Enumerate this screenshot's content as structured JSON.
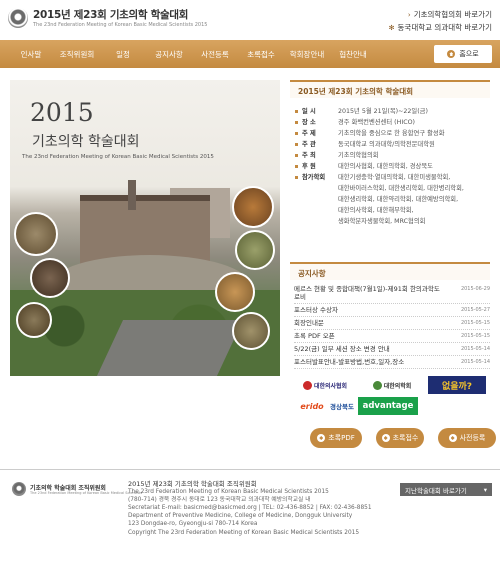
{
  "header": {
    "title": "2015년 제23회 기초의학 학술대회",
    "subtitle": "The 23nd Federation Meeting of Korean Basic Medical Scientists 2015",
    "quick_links": [
      {
        "label": "기초의학협의회 바로가기"
      },
      {
        "label": "동국대학교 의과대학 바로가기"
      }
    ]
  },
  "nav": {
    "items": [
      "인사말",
      "조직위원회",
      "일정",
      "공지사항",
      "사전등록",
      "초록접수",
      "학회장안내",
      "협찬안내"
    ],
    "home_label": "홈으로"
  },
  "hero": {
    "year": "2015",
    "title": "기초의학 학술대회",
    "subtitle_en": "The 23nd Federation Meeting of Korean Basic Medical Scientists 2015"
  },
  "info": {
    "heading": "2015년 제23회 기초의학 학술대회",
    "rows": [
      {
        "label": "일 시",
        "value": "2015년 5월 21일(목)~22일(금)"
      },
      {
        "label": "장 소",
        "value": "경주 화백컨벤션센터 (HICO)"
      },
      {
        "label": "주 제",
        "value": "기초의학을 중심으로 한 융합연구 활성화"
      },
      {
        "label": "주 관",
        "value": "동국대학교 의과대학/의학전문대학원"
      },
      {
        "label": "주 최",
        "value": "기초의학협의회"
      },
      {
        "label": "후 원",
        "value": "대한의사협회, 대한의학회, 경상북도"
      },
      {
        "label": "참가학회",
        "value": "대한기생충학·열대의학회, 대한미생물학회,"
      }
    ],
    "continuation": [
      "대한바이러스학회, 대한생리학회, 대한병리학회,",
      "대한생리학회, 대한약리학회, 대한예방의학회,",
      "대한의사학회, 대한해부학회,",
      "생화학분자생물학회, MRC협의회"
    ]
  },
  "notices": {
    "heading": "공지사항",
    "items": [
      {
        "title": "메르스 현황 및 종합대책(7월1일)-제91회 한의과학도 로비",
        "date": "2015-06-29"
      },
      {
        "title": "포스터상 수상자",
        "date": "2015-05-27"
      },
      {
        "title": "회장인내문",
        "date": "2015-05-15"
      },
      {
        "title": "초록 PDF 오픈",
        "date": "2015-05-15"
      },
      {
        "title": "5/22(금) 일부 세션 장소 변경 안내",
        "date": "2015-05-14"
      },
      {
        "title": "포스터발표안내-발표방법,번호,일자,장소",
        "date": "2015-05-14"
      }
    ]
  },
  "sponsors": {
    "s1": "대한의사협회",
    "s2": "대한의학회",
    "s3": "없을까?",
    "s4": "erido",
    "s5": "경상북도",
    "s6": "advantage"
  },
  "actions": {
    "abstract_pdf": "초록PDF",
    "abstract_submit": "초록접수",
    "pre_register": "사전등록"
  },
  "footer": {
    "org_name": "기초의학 학술대회 조직위원회",
    "org_sub": "The 23nd Federation Meeting of Korean Basic Medical Scientists",
    "lines": [
      "2015년 제23회 기초의학 학술대회 조직위원회",
      "The 23rd Federation Meeting of Korean Basic Medical Scientists 2015",
      "(780-714) 경북 경주시 동대로 123 동국대학교 의과대학 예방의학교실 내",
      "Secretariat E-mail: basicmed@basicmed.org  |  TEL: 02-436-8852  |  FAX: 02-436-8851",
      "Department of Preventive Medicine, College of Medicine, Dongguk University",
      "123 Dongdae-ro, Gyeongju-si 780-714 Korea",
      "Copyright The 23rd Federation Meeting of Korean Basic Medical Scientists 2015"
    ],
    "family_site": "지난학술대회 바로가기"
  }
}
